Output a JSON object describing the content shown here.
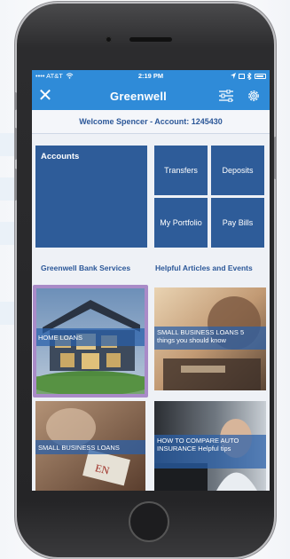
{
  "status_bar": {
    "carrier": "•••• AT&T",
    "time": "2:19 PM"
  },
  "nav": {
    "title": "Greenwell",
    "close_label": "✕"
  },
  "welcome": "Welcome Spencer - Account: 1245430",
  "tiles": {
    "accounts": "Accounts",
    "transfers": "Transfers",
    "deposits": "Deposits",
    "portfolio": "My Portfolio",
    "pay_bills": "Pay Bills"
  },
  "sections": {
    "left": "Greenwell Bank Services",
    "right": "Helpful Articles and Events"
  },
  "cards": [
    {
      "title": "HOME LOANS",
      "subtitle": ""
    },
    {
      "title": "SMALL BUSINESS LOANS",
      "subtitle": "5 things you should know"
    },
    {
      "title": "SMALL BUSINESS LOANS",
      "subtitle": ""
    },
    {
      "title": "HOW TO COMPARE AUTO INSURANCE",
      "subtitle": "Helpful tips"
    }
  ],
  "colors": {
    "nav_blue": "#2f8bd8",
    "tile_blue": "#2e5c99",
    "selection": "#a98bc8"
  }
}
